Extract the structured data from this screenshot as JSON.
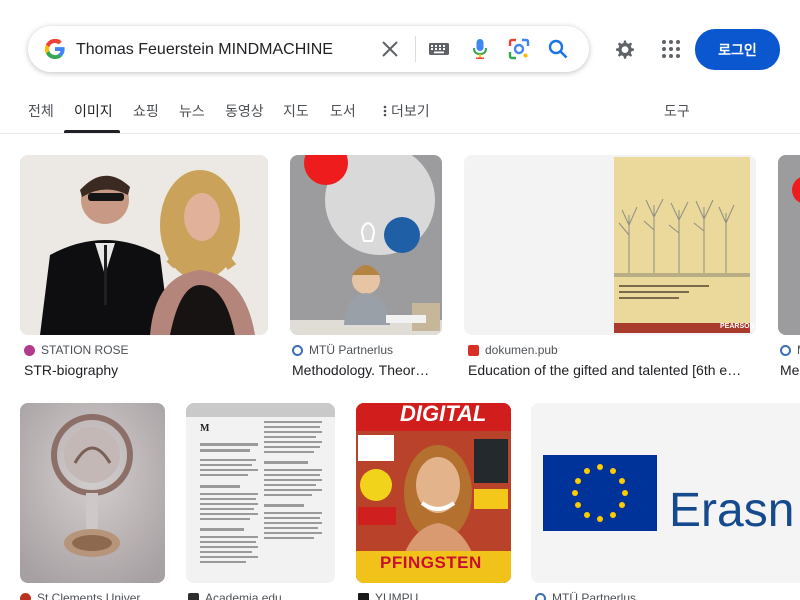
{
  "search": {
    "query": "Thomas Feuerstein MINDMACHINE",
    "clear_icon": "close-icon",
    "keyboard_icon": "keyboard-icon",
    "voice_icon": "mic-icon",
    "lens_icon": "camera-lens-icon",
    "search_icon": "search-icon"
  },
  "header": {
    "settings_icon": "gear-icon",
    "apps_icon": "apps-grid-icon",
    "login_label": "로그인"
  },
  "tabs": {
    "items": [
      "전체",
      "이미지",
      "쇼핑",
      "뉴스",
      "동영상",
      "지도",
      "도서",
      "더보기"
    ],
    "more_icon": "vertical-dots-icon",
    "tools": "도구",
    "active": "이미지"
  },
  "results": [
    {
      "source": "STATION ROSE",
      "title": "STR-biography"
    },
    {
      "source": "MTÜ Partnerlus",
      "title": "Methodology. Theor…"
    },
    {
      "source": "dokumen.pub",
      "title": "Education of the gifted and talented [6th e…"
    },
    {
      "source": "M",
      "title": "Me"
    },
    {
      "source": "St Clements Univer…",
      "title": ""
    },
    {
      "source": "Academia.edu",
      "title": ""
    },
    {
      "source": "YUMPU",
      "title": ""
    },
    {
      "source": "MTÜ Partnerlus",
      "title": ""
    }
  ],
  "image_text": {
    "book_publisher": "PEARSON",
    "paper_letter": "M",
    "magazine_title": "DIGITAL",
    "magazine_headline": "PFINGSTEN",
    "erasmus_text": "Erasn"
  },
  "colors": {
    "accent": "#0b57d0",
    "tab_active": "#202124",
    "text_secondary": "#4d5156"
  }
}
